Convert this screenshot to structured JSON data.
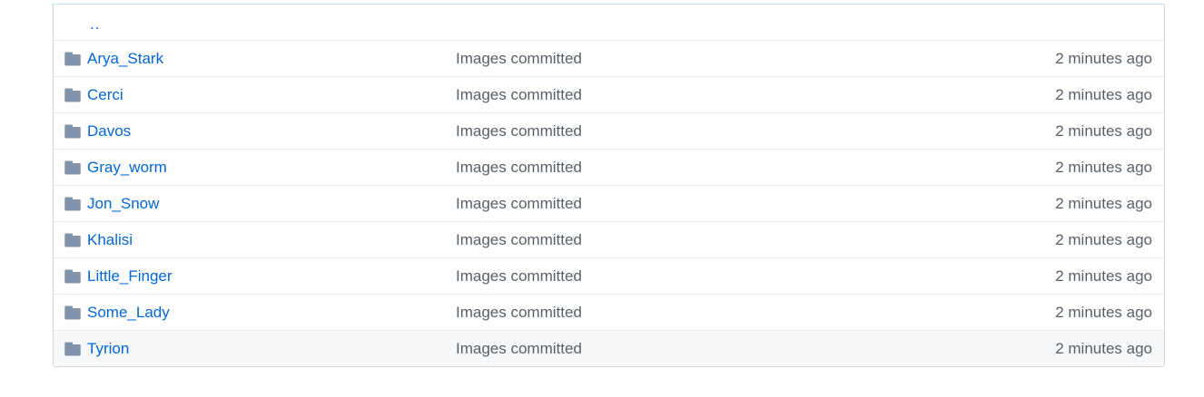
{
  "up_dir": {
    "label": ".."
  },
  "folder_icon_color": "#8093aa",
  "link_color": "#0366d6",
  "muted_color": "#586069",
  "rows": [
    {
      "name": "Arya_Stark",
      "message": "Images committed",
      "age": "2 minutes ago",
      "icon": "folder-icon"
    },
    {
      "name": "Cerci",
      "message": "Images committed",
      "age": "2 minutes ago",
      "icon": "folder-icon"
    },
    {
      "name": "Davos",
      "message": "Images committed",
      "age": "2 minutes ago",
      "icon": "folder-icon"
    },
    {
      "name": "Gray_worm",
      "message": "Images committed",
      "age": "2 minutes ago",
      "icon": "folder-icon"
    },
    {
      "name": "Jon_Snow",
      "message": "Images committed",
      "age": "2 minutes ago",
      "icon": "folder-icon"
    },
    {
      "name": "Khalisi",
      "message": "Images committed",
      "age": "2 minutes ago",
      "icon": "folder-icon"
    },
    {
      "name": "Little_Finger",
      "message": "Images committed",
      "age": "2 minutes ago",
      "icon": "folder-icon"
    },
    {
      "name": "Some_Lady",
      "message": "Images committed",
      "age": "2 minutes ago",
      "icon": "folder-icon"
    },
    {
      "name": "Tyrion",
      "message": "Images committed",
      "age": "2 minutes ago",
      "icon": "folder-icon"
    }
  ]
}
